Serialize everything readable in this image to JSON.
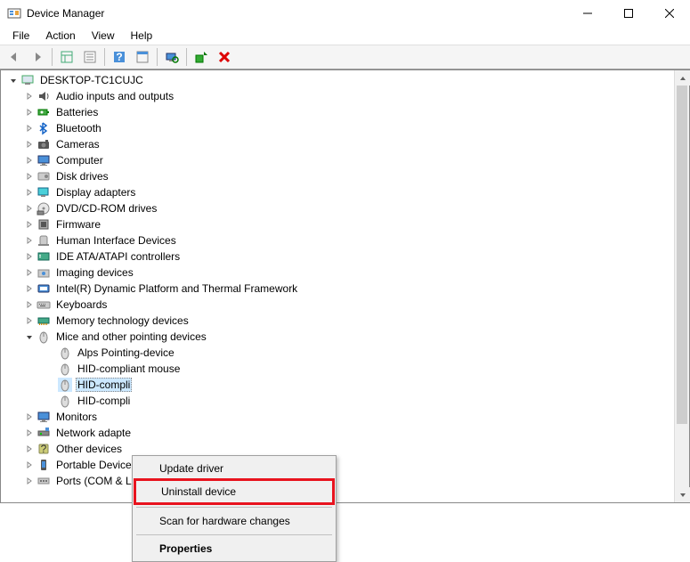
{
  "window": {
    "title": "Device Manager"
  },
  "menubar": {
    "file": "File",
    "action": "Action",
    "view": "View",
    "help": "Help"
  },
  "tree": {
    "root": "DESKTOP-TC1CUJC",
    "categories": [
      {
        "label": "Audio inputs and outputs",
        "expanded": false
      },
      {
        "label": "Batteries",
        "expanded": false
      },
      {
        "label": "Bluetooth",
        "expanded": false
      },
      {
        "label": "Cameras",
        "expanded": false
      },
      {
        "label": "Computer",
        "expanded": false
      },
      {
        "label": "Disk drives",
        "expanded": false
      },
      {
        "label": "Display adapters",
        "expanded": false
      },
      {
        "label": "DVD/CD-ROM drives",
        "expanded": false
      },
      {
        "label": "Firmware",
        "expanded": false
      },
      {
        "label": "Human Interface Devices",
        "expanded": false
      },
      {
        "label": "IDE ATA/ATAPI controllers",
        "expanded": false
      },
      {
        "label": "Imaging devices",
        "expanded": false
      },
      {
        "label": "Intel(R) Dynamic Platform and Thermal Framework",
        "expanded": false
      },
      {
        "label": "Keyboards",
        "expanded": false
      },
      {
        "label": "Memory technology devices",
        "expanded": false
      },
      {
        "label": "Mice and other pointing devices",
        "expanded": true,
        "devices": [
          {
            "label": "Alps Pointing-device"
          },
          {
            "label": "HID-compliant mouse"
          },
          {
            "label": "HID-compli",
            "selected": true
          },
          {
            "label": "HID-compli"
          }
        ]
      },
      {
        "label": "Monitors",
        "expanded": false
      },
      {
        "label": "Network adapte",
        "expanded": false
      },
      {
        "label": "Other devices",
        "expanded": false
      },
      {
        "label": "Portable Device",
        "expanded": false
      },
      {
        "label": "Ports (COM & LPT)",
        "expanded": false
      }
    ]
  },
  "context_menu": {
    "update": "Update driver",
    "uninstall": "Uninstall device",
    "scan": "Scan for hardware changes",
    "properties": "Properties"
  }
}
